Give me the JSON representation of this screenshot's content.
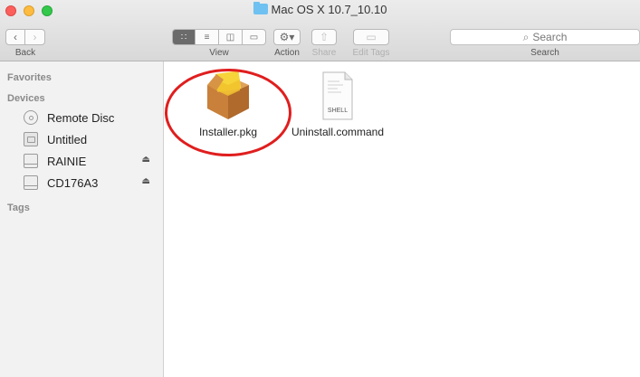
{
  "window": {
    "title": "Mac OS X 10.7_10.10"
  },
  "toolbar": {
    "back_label": "Back",
    "view_label": "View",
    "action_label": "Action",
    "share_label": "Share",
    "edit_tags_label": "Edit Tags",
    "search_placeholder": "Search",
    "search_label": "Search"
  },
  "sidebar": {
    "favorites_header": "Favorites",
    "devices_header": "Devices",
    "tags_header": "Tags",
    "devices": [
      {
        "label": "Remote Disc",
        "icon": "disc-icon",
        "ejectable": false
      },
      {
        "label": "Untitled",
        "icon": "hard-drive-icon",
        "ejectable": false
      },
      {
        "label": "RAINIE",
        "icon": "drive-icon",
        "ejectable": true
      },
      {
        "label": "CD176A3",
        "icon": "drive-icon",
        "ejectable": true
      }
    ],
    "eject_glyph": "⏏"
  },
  "files": [
    {
      "name": "Installer.pkg",
      "icon": "package-icon",
      "highlighted": true
    },
    {
      "name": "Uninstall.command",
      "icon": "shell-script-icon",
      "badge": "SHELL"
    }
  ],
  "colors": {
    "highlight": "#e01e1e",
    "folder": "#6ec1f0"
  }
}
